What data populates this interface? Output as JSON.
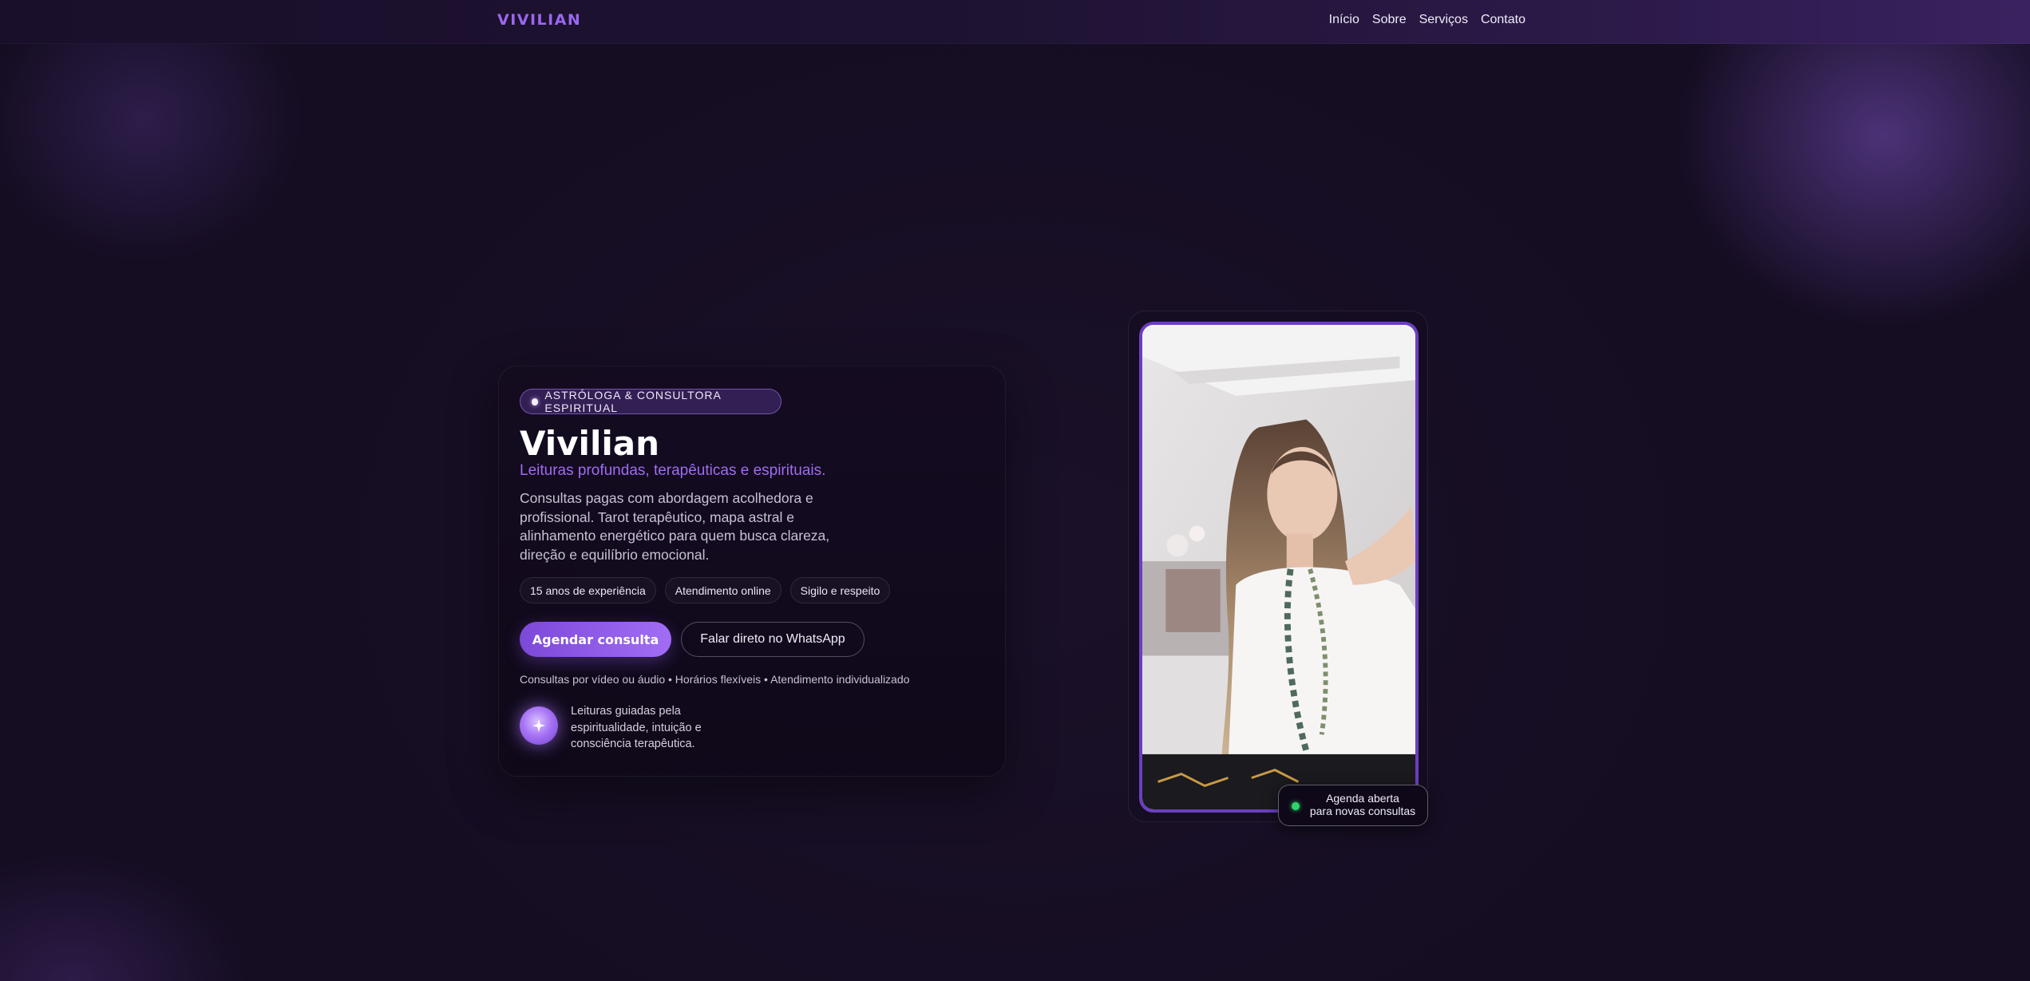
{
  "header": {
    "logo": "VIVILIAN",
    "nav": [
      "Início",
      "Sobre",
      "Serviços",
      "Contato"
    ]
  },
  "hero": {
    "badge": "ASTRÓLOGA & CONSULTORA ESPIRITUAL",
    "title": "Vivilian",
    "subtitle": "Leituras profundas, terapêuticas e espirituais.",
    "description": "Consultas pagas com abordagem acolhedora e profissional. Tarot terapêutico, mapa astral e alinhamento energético para quem busca clareza, direção e equilíbrio emocional.",
    "tags": [
      "15 anos de experiência",
      "Atendimento online",
      "Sigilo e respeito"
    ],
    "primary_button": "Agendar consulta",
    "secondary_button": "Falar direto no WhatsApp",
    "note": "Consultas por vídeo ou áudio • Horários flexíveis • Atendimento individualizado",
    "spark_text": "Leituras guiadas pela espiritualidade, intuição e consciência terapêutica."
  },
  "photo": {
    "status_line1": "Agenda aberta",
    "status_line2": "para novas consultas"
  },
  "colors": {
    "accent": "#9b67f0",
    "background": "#150d22",
    "status_green": "#2fd36a"
  }
}
